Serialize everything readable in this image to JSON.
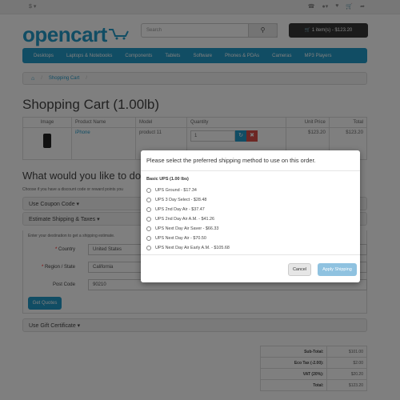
{
  "topbar": {
    "currency": "$ ▾",
    "icons": [
      "phone-icon",
      "user-icon",
      "heart-icon",
      "cart-icon",
      "share-icon"
    ]
  },
  "header": {
    "logo": "opencart",
    "search_placeholder": "Search",
    "cart_button": "1 item(s) - $123.20"
  },
  "nav": [
    "Desktops",
    "Laptops & Notebooks",
    "Components",
    "Tablets",
    "Software",
    "Phones & PDAs",
    "Cameras",
    "MP3 Players"
  ],
  "breadcrumb": {
    "current": "Shopping Cart"
  },
  "page_title": "Shopping Cart  (1.00lb)",
  "cart_table": {
    "headers": [
      "Image",
      "Product Name",
      "Model",
      "Quantity",
      "Unit Price",
      "Total"
    ],
    "row": {
      "name": "iPhone",
      "model": "product 11",
      "quantity": "1",
      "unit_price": "$123.20",
      "total": "$123.20"
    }
  },
  "next_steps": {
    "title": "What would you like to do",
    "description": "Choose if you have a discount code or reward points you",
    "coupon": "Use Coupon Code ▾",
    "shipping": "Estimate Shipping & Taxes ▾",
    "shipping_desc": "Enter your destination to get a shipping estimate.",
    "country_label": "Country",
    "country_value": "United States",
    "region_label": "Region / State",
    "region_value": "California",
    "postcode_label": "Post Code",
    "postcode_value": "90210",
    "quotes_button": "Get Quotes",
    "gift": "Use Gift Certificate ▾"
  },
  "totals": [
    {
      "label": "Sub-Total:",
      "value": "$101.00"
    },
    {
      "label": "Eco Tax (-2.00):",
      "value": "$2.00"
    },
    {
      "label": "VAT (20%):",
      "value": "$20.20"
    },
    {
      "label": "Total:",
      "value": "$123.20"
    }
  ],
  "modal": {
    "title": "Please select the preferred shipping method to use on this order.",
    "group": "Basic UPS (1.00 lbs)",
    "options": [
      "UPS Ground - $17.34",
      "UPS 3 Day Select - $28.48",
      "UPS 2nd Day Air - $37.47",
      "UPS 2nd Day Air A.M. - $41.26",
      "UPS Next Day Air Saver - $66.33",
      "UPS Next Day Air - $70.50",
      "UPS Next Day Air Early A.M. - $105.68"
    ],
    "cancel": "Cancel",
    "apply": "Apply Shipping"
  }
}
